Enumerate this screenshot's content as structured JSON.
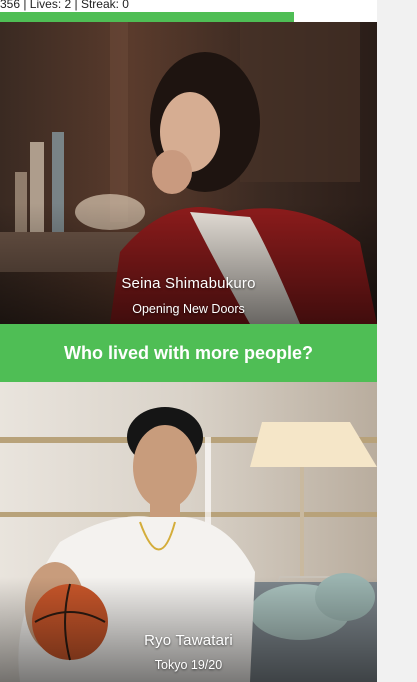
{
  "stats": {
    "text": "356 | Lives: 2 | Streak: 0"
  },
  "progress": {
    "fraction": 0.78,
    "color": "#4fbe55"
  },
  "question": {
    "text": "Who lived with more people?"
  },
  "cards": [
    {
      "name": "Seina Shimabukuro",
      "subtitle": "Opening New Doors"
    },
    {
      "name": "Ryo Tawatari",
      "subtitle": "Tokyo 19/20"
    }
  ],
  "colors": {
    "accent": "#4fbe55",
    "gutter": "#f1f1f1"
  }
}
